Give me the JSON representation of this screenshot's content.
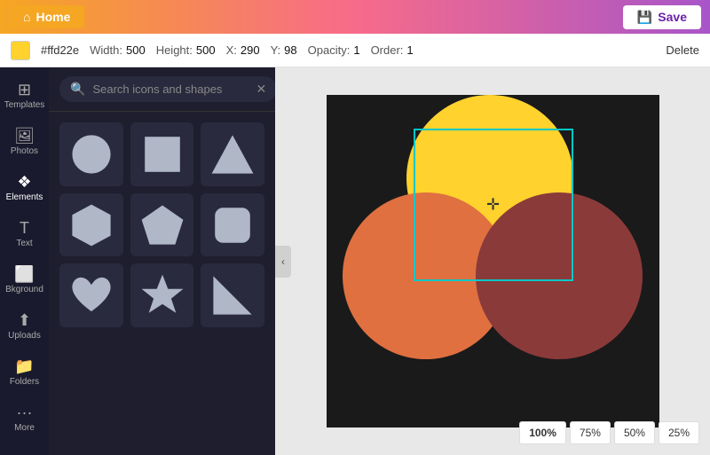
{
  "topbar": {
    "home_label": "Home",
    "home_icon": "⌂",
    "save_label": "Save",
    "save_icon": "💾"
  },
  "propbar": {
    "color_hex": "#ffd22e",
    "color_bg": "#ffd22e",
    "width_label": "Width:",
    "width_value": "500",
    "height_label": "Height:",
    "height_value": "500",
    "x_label": "X:",
    "x_value": "290",
    "y_label": "Y:",
    "y_value": "98",
    "opacity_label": "Opacity:",
    "opacity_value": "1",
    "order_label": "Order:",
    "order_value": "1",
    "delete_label": "Delete"
  },
  "sidebar": {
    "items": [
      {
        "id": "templates",
        "label": "Templates",
        "icon": "⊞"
      },
      {
        "id": "photos",
        "label": "Photos",
        "icon": "🖼"
      },
      {
        "id": "elements",
        "label": "Elements",
        "icon": "❖"
      },
      {
        "id": "text",
        "label": "Text",
        "icon": "T"
      },
      {
        "id": "background",
        "label": "Bkground",
        "icon": "⬜"
      },
      {
        "id": "uploads",
        "label": "Uploads",
        "icon": "⬆"
      },
      {
        "id": "folders",
        "label": "Folders",
        "icon": "📁"
      },
      {
        "id": "more",
        "label": "More",
        "icon": "···"
      }
    ]
  },
  "search": {
    "placeholder": "Search icons and shapes",
    "value": ""
  },
  "shapes": [
    {
      "id": "circle",
      "type": "circle"
    },
    {
      "id": "square",
      "type": "square"
    },
    {
      "id": "triangle",
      "type": "triangle"
    },
    {
      "id": "hexagon",
      "type": "hexagon"
    },
    {
      "id": "pentagon",
      "type": "pentagon"
    },
    {
      "id": "rounded-square",
      "type": "rounded-square"
    },
    {
      "id": "heart",
      "type": "heart"
    },
    {
      "id": "star",
      "type": "star"
    },
    {
      "id": "triangle-right",
      "type": "triangle-right"
    }
  ],
  "canvas": {
    "circles": [
      {
        "id": "yellow",
        "color": "#ffd22e"
      },
      {
        "id": "orange",
        "color": "#e07040"
      },
      {
        "id": "brown",
        "color": "#8b3a3a"
      }
    ]
  },
  "zoom": {
    "options": [
      "100%",
      "75%",
      "50%",
      "25%"
    ],
    "active": "100%"
  }
}
